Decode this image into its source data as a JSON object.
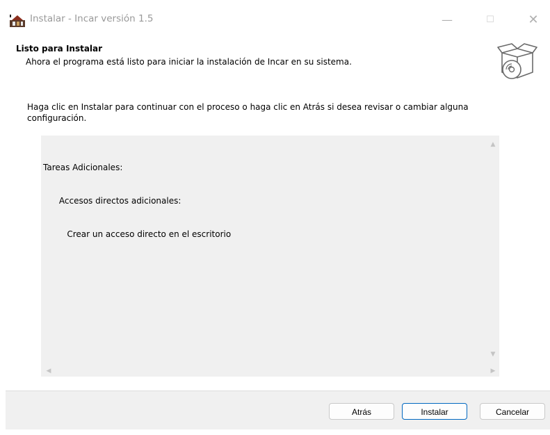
{
  "window": {
    "title": "Instalar - Incar versión 1.5",
    "controls": {
      "minimize": "—",
      "maximize": "☐",
      "close": "✕"
    }
  },
  "header": {
    "title": "Listo para Instalar",
    "subtitle": "Ahora el programa está listo para iniciar la instalación de Incar en su sistema."
  },
  "content": {
    "description": "Haga clic en Instalar para continuar con el proceso o haga clic en Atrás si desea revisar o cambiar alguna configuración.",
    "memo_lines": [
      "Tareas Adicionales:",
      "      Accesos directos adicionales:",
      "         Crear un acceso directo en el escritorio"
    ],
    "scroll_arrows": {
      "up": "▲",
      "down": "▼",
      "left": "◀",
      "right": "▶"
    }
  },
  "footer": {
    "back_label": "Atrás",
    "install_label": "Instalar",
    "cancel_label": "Cancelar"
  },
  "icons": {
    "app": "installer-app-icon",
    "header": "setup-box-cd-icon"
  },
  "colors": {
    "accent": "#0067c0",
    "title_text": "#999999",
    "footer_bg": "#f0f0f0",
    "memo_bg": "#f0f0f0"
  }
}
